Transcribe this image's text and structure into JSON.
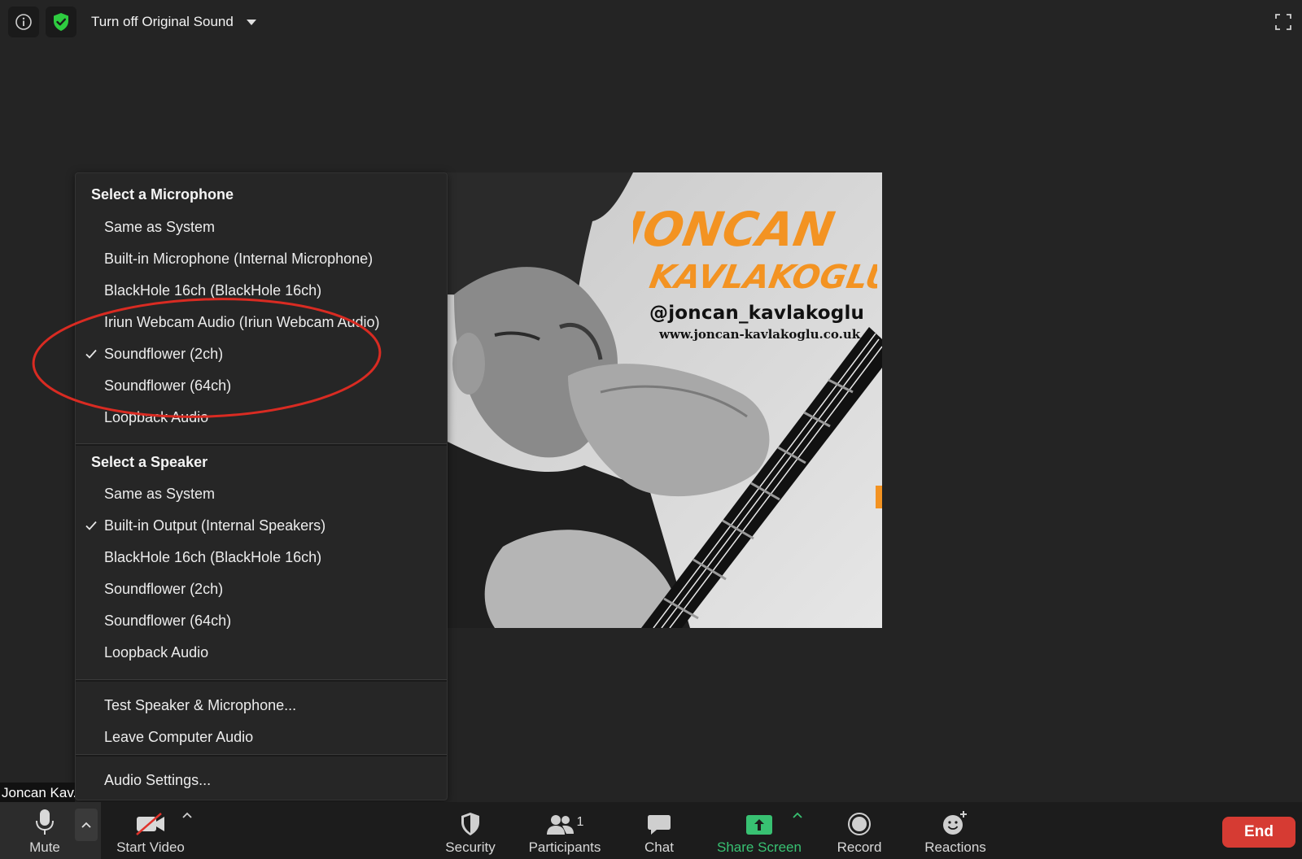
{
  "top_bar": {
    "original_sound_label": "Turn off Original Sound",
    "icons": [
      "info-icon",
      "shield-check-icon",
      "caret-down-icon",
      "fullscreen-icon"
    ],
    "security_color": "#2ecc40"
  },
  "video": {
    "brand_line1": "JONCAN",
    "brand_line2": "KAVLAKOGLU",
    "handle": "@joncan_kavlakoglu",
    "website": "www.joncan-kavlakoglu.co.uk",
    "brand_color": "#f39322"
  },
  "audio_menu": {
    "microphone_title": "Select a Microphone",
    "microphones": [
      {
        "label": "Same as System",
        "checked": false
      },
      {
        "label": "Built-in Microphone (Internal Microphone)",
        "checked": false
      },
      {
        "label": "BlackHole 16ch (BlackHole 16ch)",
        "checked": false
      },
      {
        "label": "Iriun Webcam Audio (Iriun Webcam Audio)",
        "checked": false
      },
      {
        "label": "Soundflower (2ch)",
        "checked": true
      },
      {
        "label": "Soundflower (64ch)",
        "checked": false
      },
      {
        "label": "Loopback Audio",
        "checked": false
      }
    ],
    "speaker_title": "Select a Speaker",
    "speakers": [
      {
        "label": "Same as System",
        "checked": false
      },
      {
        "label": "Built-in Output (Internal Speakers)",
        "checked": true
      },
      {
        "label": "BlackHole 16ch (BlackHole 16ch)",
        "checked": false
      },
      {
        "label": "Soundflower (2ch)",
        "checked": false
      },
      {
        "label": "Soundflower (64ch)",
        "checked": false
      },
      {
        "label": "Loopback Audio",
        "checked": false
      }
    ],
    "test_label": "Test Speaker & Microphone...",
    "leave_label": "Leave Computer Audio",
    "settings_label": "Audio Settings...",
    "annotation_color": "#d92b22"
  },
  "participant_name": "Joncan Kav...",
  "toolbar": {
    "mute_label": "Mute",
    "start_video_label": "Start Video",
    "security_label": "Security",
    "participants_label": "Participants",
    "participants_count": "1",
    "chat_label": "Chat",
    "share_screen_label": "Share Screen",
    "record_label": "Record",
    "reactions_label": "Reactions",
    "end_label": "End",
    "share_color": "#38c172",
    "end_color": "#d63b33"
  }
}
